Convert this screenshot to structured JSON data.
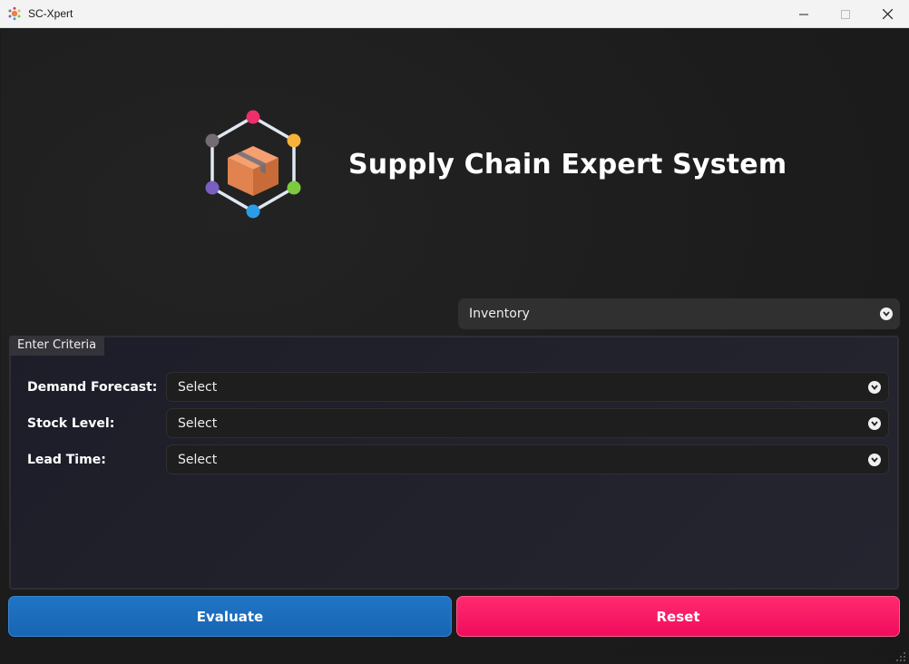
{
  "window": {
    "title": "SC-Xpert",
    "controls": [
      "minimize-icon",
      "maximize-icon",
      "close-icon"
    ]
  },
  "header": {
    "title": "Supply Chain Expert System",
    "logo": "package-network-icon"
  },
  "category_select": {
    "value": "Inventory"
  },
  "criteria": {
    "tab_label": "Enter Criteria",
    "fields": [
      {
        "label": "Demand Forecast:",
        "value": "Select"
      },
      {
        "label": "Stock Level:",
        "value": "Select"
      },
      {
        "label": "Lead Time:",
        "value": "Select"
      }
    ]
  },
  "actions": {
    "evaluate_label": "Evaluate",
    "reset_label": "Reset"
  },
  "colors": {
    "evaluate": "#1a6cba",
    "reset": "#f81a66",
    "background": "#1c1c1c"
  }
}
